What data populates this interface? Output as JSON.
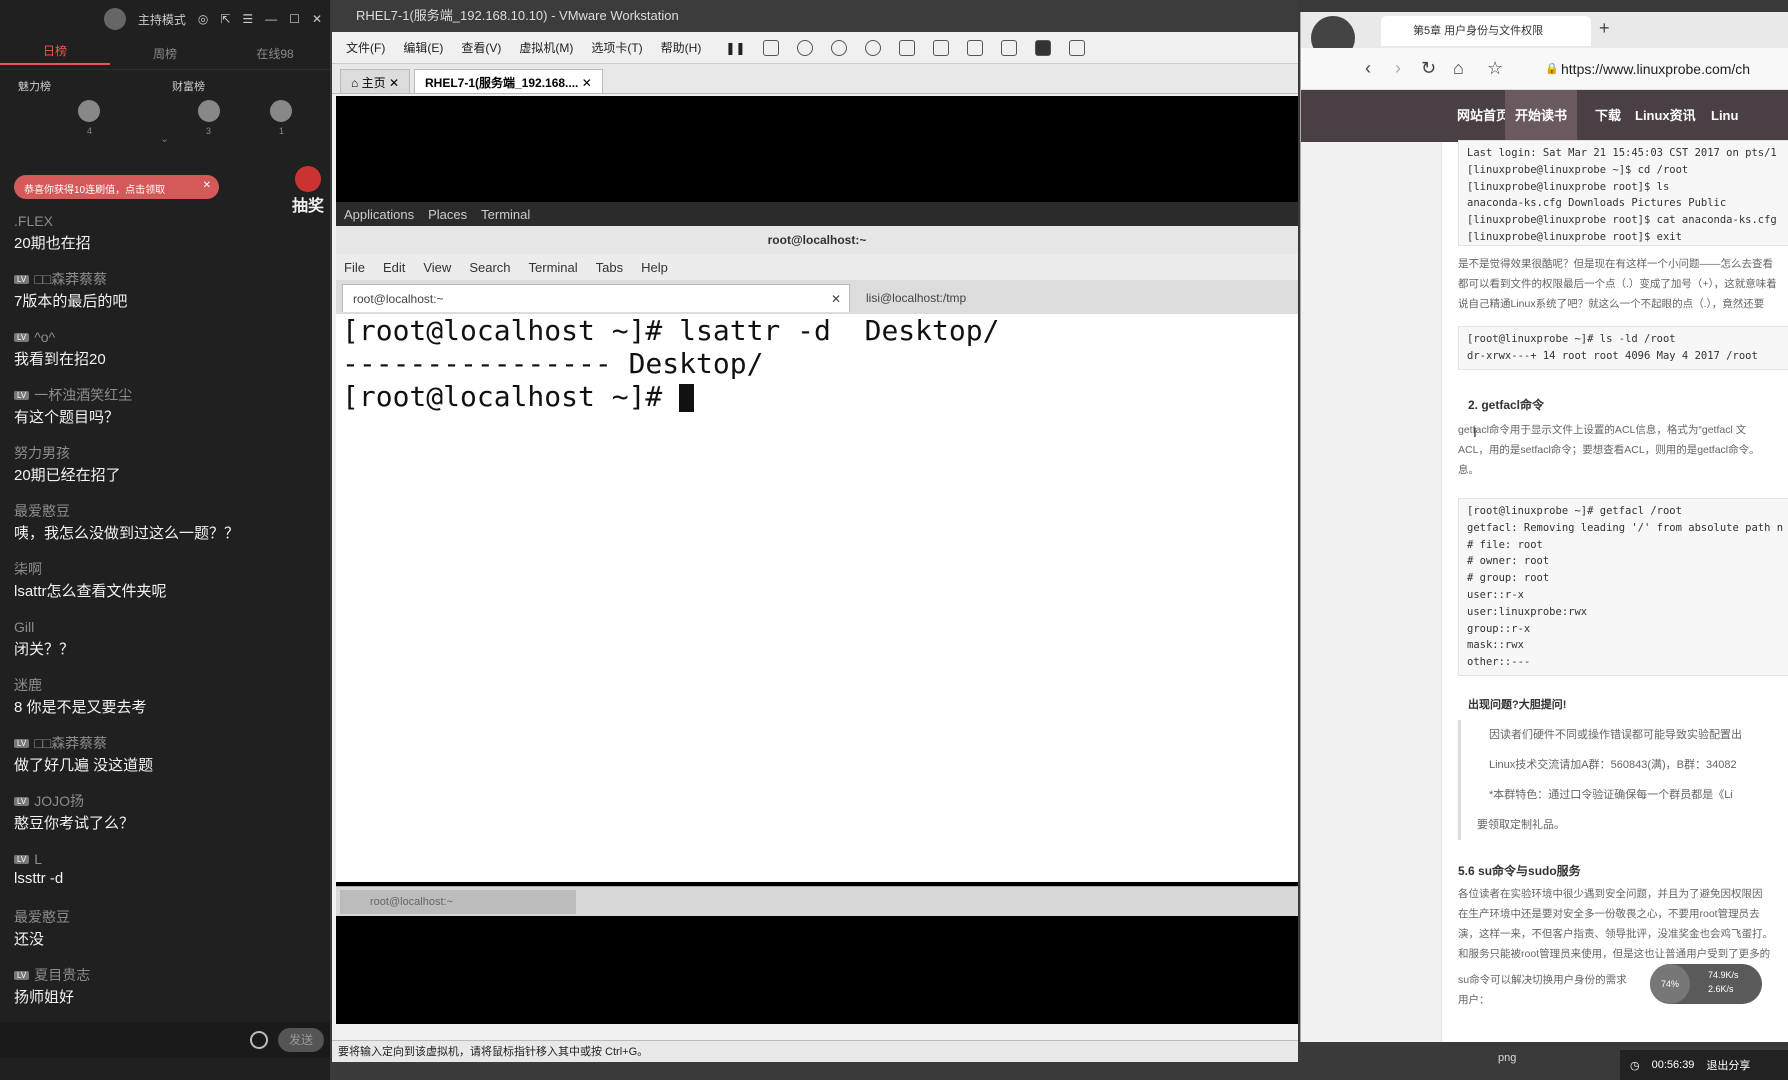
{
  "chat": {
    "mode": "主持模式",
    "tabs": [
      "日榜",
      "周榜",
      "在线98"
    ],
    "rank_labels": [
      "魅力榜",
      "财富榜"
    ],
    "rank_nums": [
      "4",
      "3",
      "1"
    ],
    "banner": "恭喜你获得10连刷值，点击领取",
    "lottery": "抽奖",
    "messages": [
      {
        "name": ".FLEX",
        "lv": "",
        "text": "20期也在招"
      },
      {
        "name": "□□森莽蔡蔡",
        "lv": "LV",
        "text": "7版本的最后的吧"
      },
      {
        "name": "^o^",
        "lv": "LV",
        "text": "我看到在招20"
      },
      {
        "name": "一杯浊酒笑红尘",
        "lv": "LV",
        "text": "有这个题目吗？"
      },
      {
        "name": "努力男孩",
        "lv": "",
        "text": "20期已经在招了"
      },
      {
        "name": "最爱憨豆",
        "lv": "",
        "text": "咦，我怎么没做到过这么一题？？"
      },
      {
        "name": "柒啊",
        "lv": "",
        "text": "lsattr怎么查看文件夹呢"
      },
      {
        "name": "Gill",
        "lv": "",
        "text": "闭关？？"
      },
      {
        "name": "迷鹿",
        "lv": "",
        "text": "8 你是不是又要去考"
      },
      {
        "name": "□□森莽蔡蔡",
        "lv": "LV",
        "text": "做了好几遍 没这道题"
      },
      {
        "name": "JOJO扬",
        "lv": "LV",
        "text": "憨豆你考试了么？"
      },
      {
        "name": "L",
        "lv": "LV",
        "text": "lssttr -d"
      },
      {
        "name": "最爱憨豆",
        "lv": "",
        "text": "还没"
      },
      {
        "name": "夏目贵志",
        "lv": "LV",
        "text": "扬师姐好"
      }
    ],
    "send_label": "发送"
  },
  "vmware": {
    "title": "RHEL7-1(服务端_192.168.10.10) - VMware Workstation",
    "menu": [
      "文件(F)",
      "编辑(E)",
      "查看(V)",
      "虚拟机(M)",
      "选项卡(T)",
      "帮助(H)"
    ],
    "tabs": [
      "主页",
      "RHEL7-1(服务端_192.168...."
    ],
    "status": "要将输入定向到该虚拟机，请将鼠标指针移入其中或按 Ctrl+G。"
  },
  "guest": {
    "gnome": [
      "Applications",
      "Places",
      "Terminal"
    ],
    "term_title": "root@localhost:~",
    "term_menu": [
      "File",
      "Edit",
      "View",
      "Search",
      "Terminal",
      "Tabs",
      "Help"
    ],
    "term_tabs": [
      "root@localhost:~",
      "lisi@localhost:/tmp"
    ],
    "lines": [
      "[root@localhost ~]# lsattr -d  Desktop/",
      "---------------- Desktop/",
      "[root@localhost ~]# "
    ],
    "taskbar_item": "root@localhost:~"
  },
  "browser": {
    "tab_title": "第5章 用户身份与文件权限",
    "url": "https://www.linuxprobe.com/ch",
    "site_nav": [
      "网站首页",
      "开始读书",
      "下载",
      "Linux资讯",
      "Linu"
    ],
    "code1": "Last login: Sat Mar 21 15:45:03 CST 2017 on pts/1\n[linuxprobe@linuxprobe ~]$ cd /root\n[linuxprobe@linuxprobe root]$ ls\nanaconda-ks.cfg Downloads Pictures Public\n[linuxprobe@linuxprobe root]$ cat anaconda-ks.cfg\n[linuxprobe@linuxprobe root]$ exit",
    "para1": "是不是觉得效果很酷呢？但是现在有这样一个小问题——怎么去查看\n都可以看到文件的权限最后一个点（.）变成了加号（+），这就意味着\n说自己精通Linux系统了吧？就这么一个不起眼的点（.），竟然还要",
    "code2": "[root@linuxprobe ~]# ls -ld /root\ndr-xrwx---+ 14 root root 4096 May 4 2017 /root",
    "heading2": "2. getfacl命令",
    "para2": "getfacl命令用于显示文件上设置的ACL信息，格式为“getfacl 文\nACL，用的是setfacl命令；要想查看ACL，则用的是getfacl命令。\n息。",
    "code3": "[root@linuxprobe ~]# getfacl /root\ngetfacl: Removing leading '/' from absolute path n\n# file: root\n# owner: root\n# group: root\nuser::r-x\nuser:linuxprobe:rwx\ngroup::r-x\nmask::rwx\nother::---",
    "ask": "出现问题?大胆提问!",
    "quote": [
      "因读者们硬件不同或操作错误都可能导致实验配置出",
      "Linux技术交流请加A群：560843(满)，B群：34082",
      "*本群特色：通过口令验证确保每一个群员都是《Li",
      "要领取定制礼品。"
    ],
    "heading3": "5.6 su命令与sudo服务",
    "para3": "各位读者在实验环境中很少遇到安全问题，并且为了避免因权限因\n在生产环境中还是要对安全多一份敬畏之心，不要用root管理员去\n演，这样一来，不但客户指责、领导批评，没准奖金也会鸡飞蛋打。\n和服务只能被root管理员来使用，但是这也让普通用户受到了更多的",
    "para4": "su命令可以解决切换用户身份的需求\n用户：",
    "speed_ball": "74%",
    "speed_up": "74.9K/s",
    "speed_down": "2.6K/s"
  },
  "overlay": {
    "time": "00:56:39",
    "exit_share": "退出分享",
    "png": "png"
  }
}
